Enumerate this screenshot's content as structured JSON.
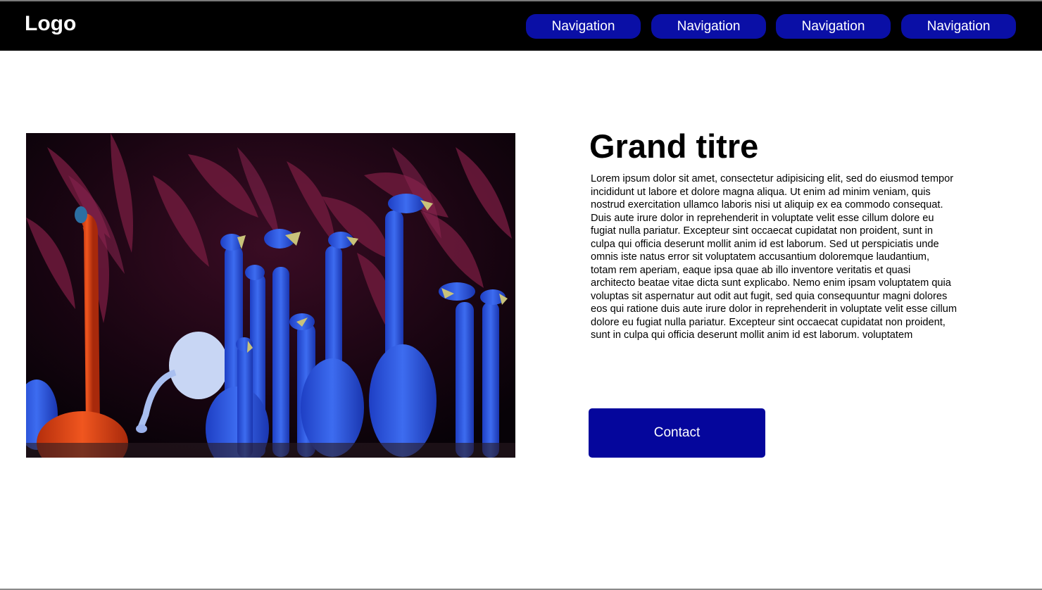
{
  "header": {
    "logo": "Logo",
    "nav": [
      {
        "label": "Navigation"
      },
      {
        "label": "Navigation"
      },
      {
        "label": "Navigation"
      },
      {
        "label": "Navigation"
      }
    ]
  },
  "hero": {
    "image_icon": "flamingos-photo",
    "title": "Grand titre",
    "body": "Lorem ipsum dolor sit amet, consectetur adipisicing elit, sed do eiusmod tempor incididunt ut labore et dolore magna aliqua. Ut enim ad minim veniam, quis nostrud exercitation ullamco laboris nisi ut aliquip ex ea commodo consequat. Duis aute irure dolor in reprehenderit in voluptate velit esse cillum dolore eu fugiat nulla pariatur. Excepteur sint occaecat cupidatat non proident, sunt in culpa qui officia deserunt mollit anim id est laborum. Sed ut perspiciatis unde omnis iste natus error sit voluptatem accusantium doloremque laudantium, totam rem aperiam, eaque ipsa quae ab illo inventore veritatis et quasi architecto beatae vitae dicta sunt explicabo. Nemo enim ipsam voluptatem quia voluptas sit aspernatur aut odit aut fugit, sed quia consequuntur magni dolores eos qui ratione duis aute irure dolor in reprehenderit in voluptate velit esse cillum dolore eu fugiat nulla pariatur. Excepteur sint occaecat cupidatat non proident, sunt in culpa qui officia deserunt mollit anim id est laborum. voluptatem",
    "cta_label": "Contact"
  },
  "colors": {
    "header_bg": "#000000",
    "nav_button": "#0a0fa6",
    "cta_button": "#05069c",
    "flamingo_blue": "#2b5bdc",
    "flamingo_orange": "#e0451a"
  }
}
